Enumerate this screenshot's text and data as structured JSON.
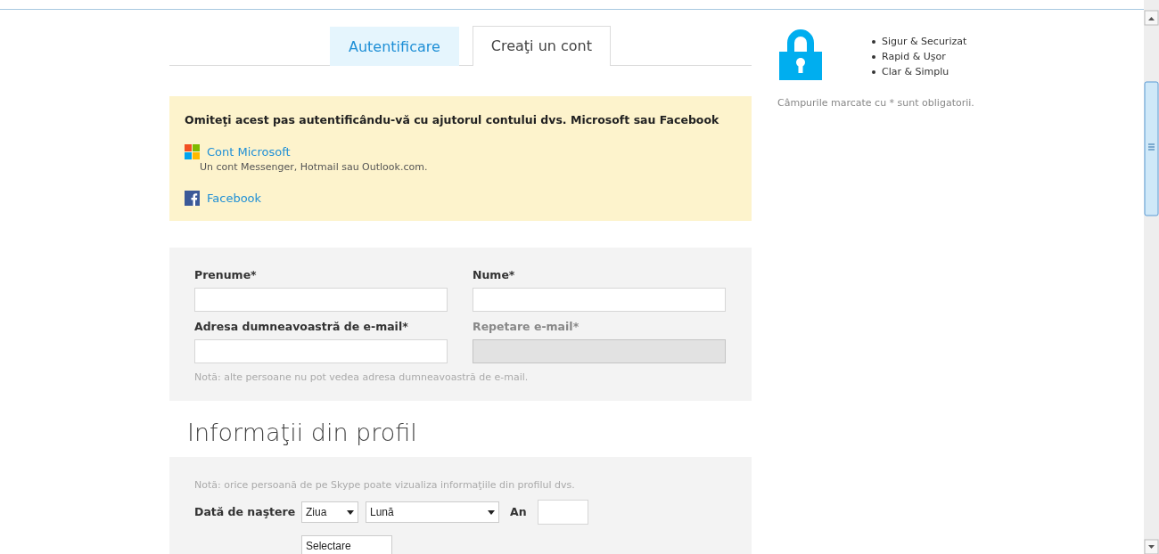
{
  "tabs": [
    {
      "label": "Autentificare",
      "selected": false
    },
    {
      "label": "Creaţi un cont",
      "selected": true
    }
  ],
  "signin_box": {
    "title": "Omiteţi acest pas autentificându-vă cu ajutorul contului dvs. Microsoft sau Facebook",
    "providers": [
      {
        "kind": "microsoft",
        "label": "Cont Microsoft",
        "note": "Un cont Messenger, Hotmail sau Outlook.com."
      },
      {
        "kind": "facebook",
        "label": "Facebook"
      }
    ]
  },
  "account_form": {
    "fields": [
      {
        "label": "Prenume*",
        "disabled": false
      },
      {
        "label": "Nume*",
        "disabled": false
      },
      {
        "label": "Adresa dumneavoastră de e-mail*",
        "disabled": false
      },
      {
        "label": "Repetare e-mail*",
        "disabled": true
      }
    ],
    "note": "Notă: alte persoane nu pot vedea adresa dumneavoastră de e-mail."
  },
  "profile": {
    "heading": "Informaţii din profil",
    "note": "Notă: orice persoană de pe Skype poate vizualiza informaţiile din profilul dvs.",
    "birth_label": "Dată de naştere",
    "day": "Ziua",
    "month": "Lună",
    "year_label": "An",
    "gender_select": "Selectare"
  },
  "sidebar": {
    "benefits": [
      "Sigur & Securizat",
      "Rapid & Uşor",
      "Clar & Simplu"
    ],
    "required_note": "Câmpurile marcate cu * sunt obligatorii."
  }
}
